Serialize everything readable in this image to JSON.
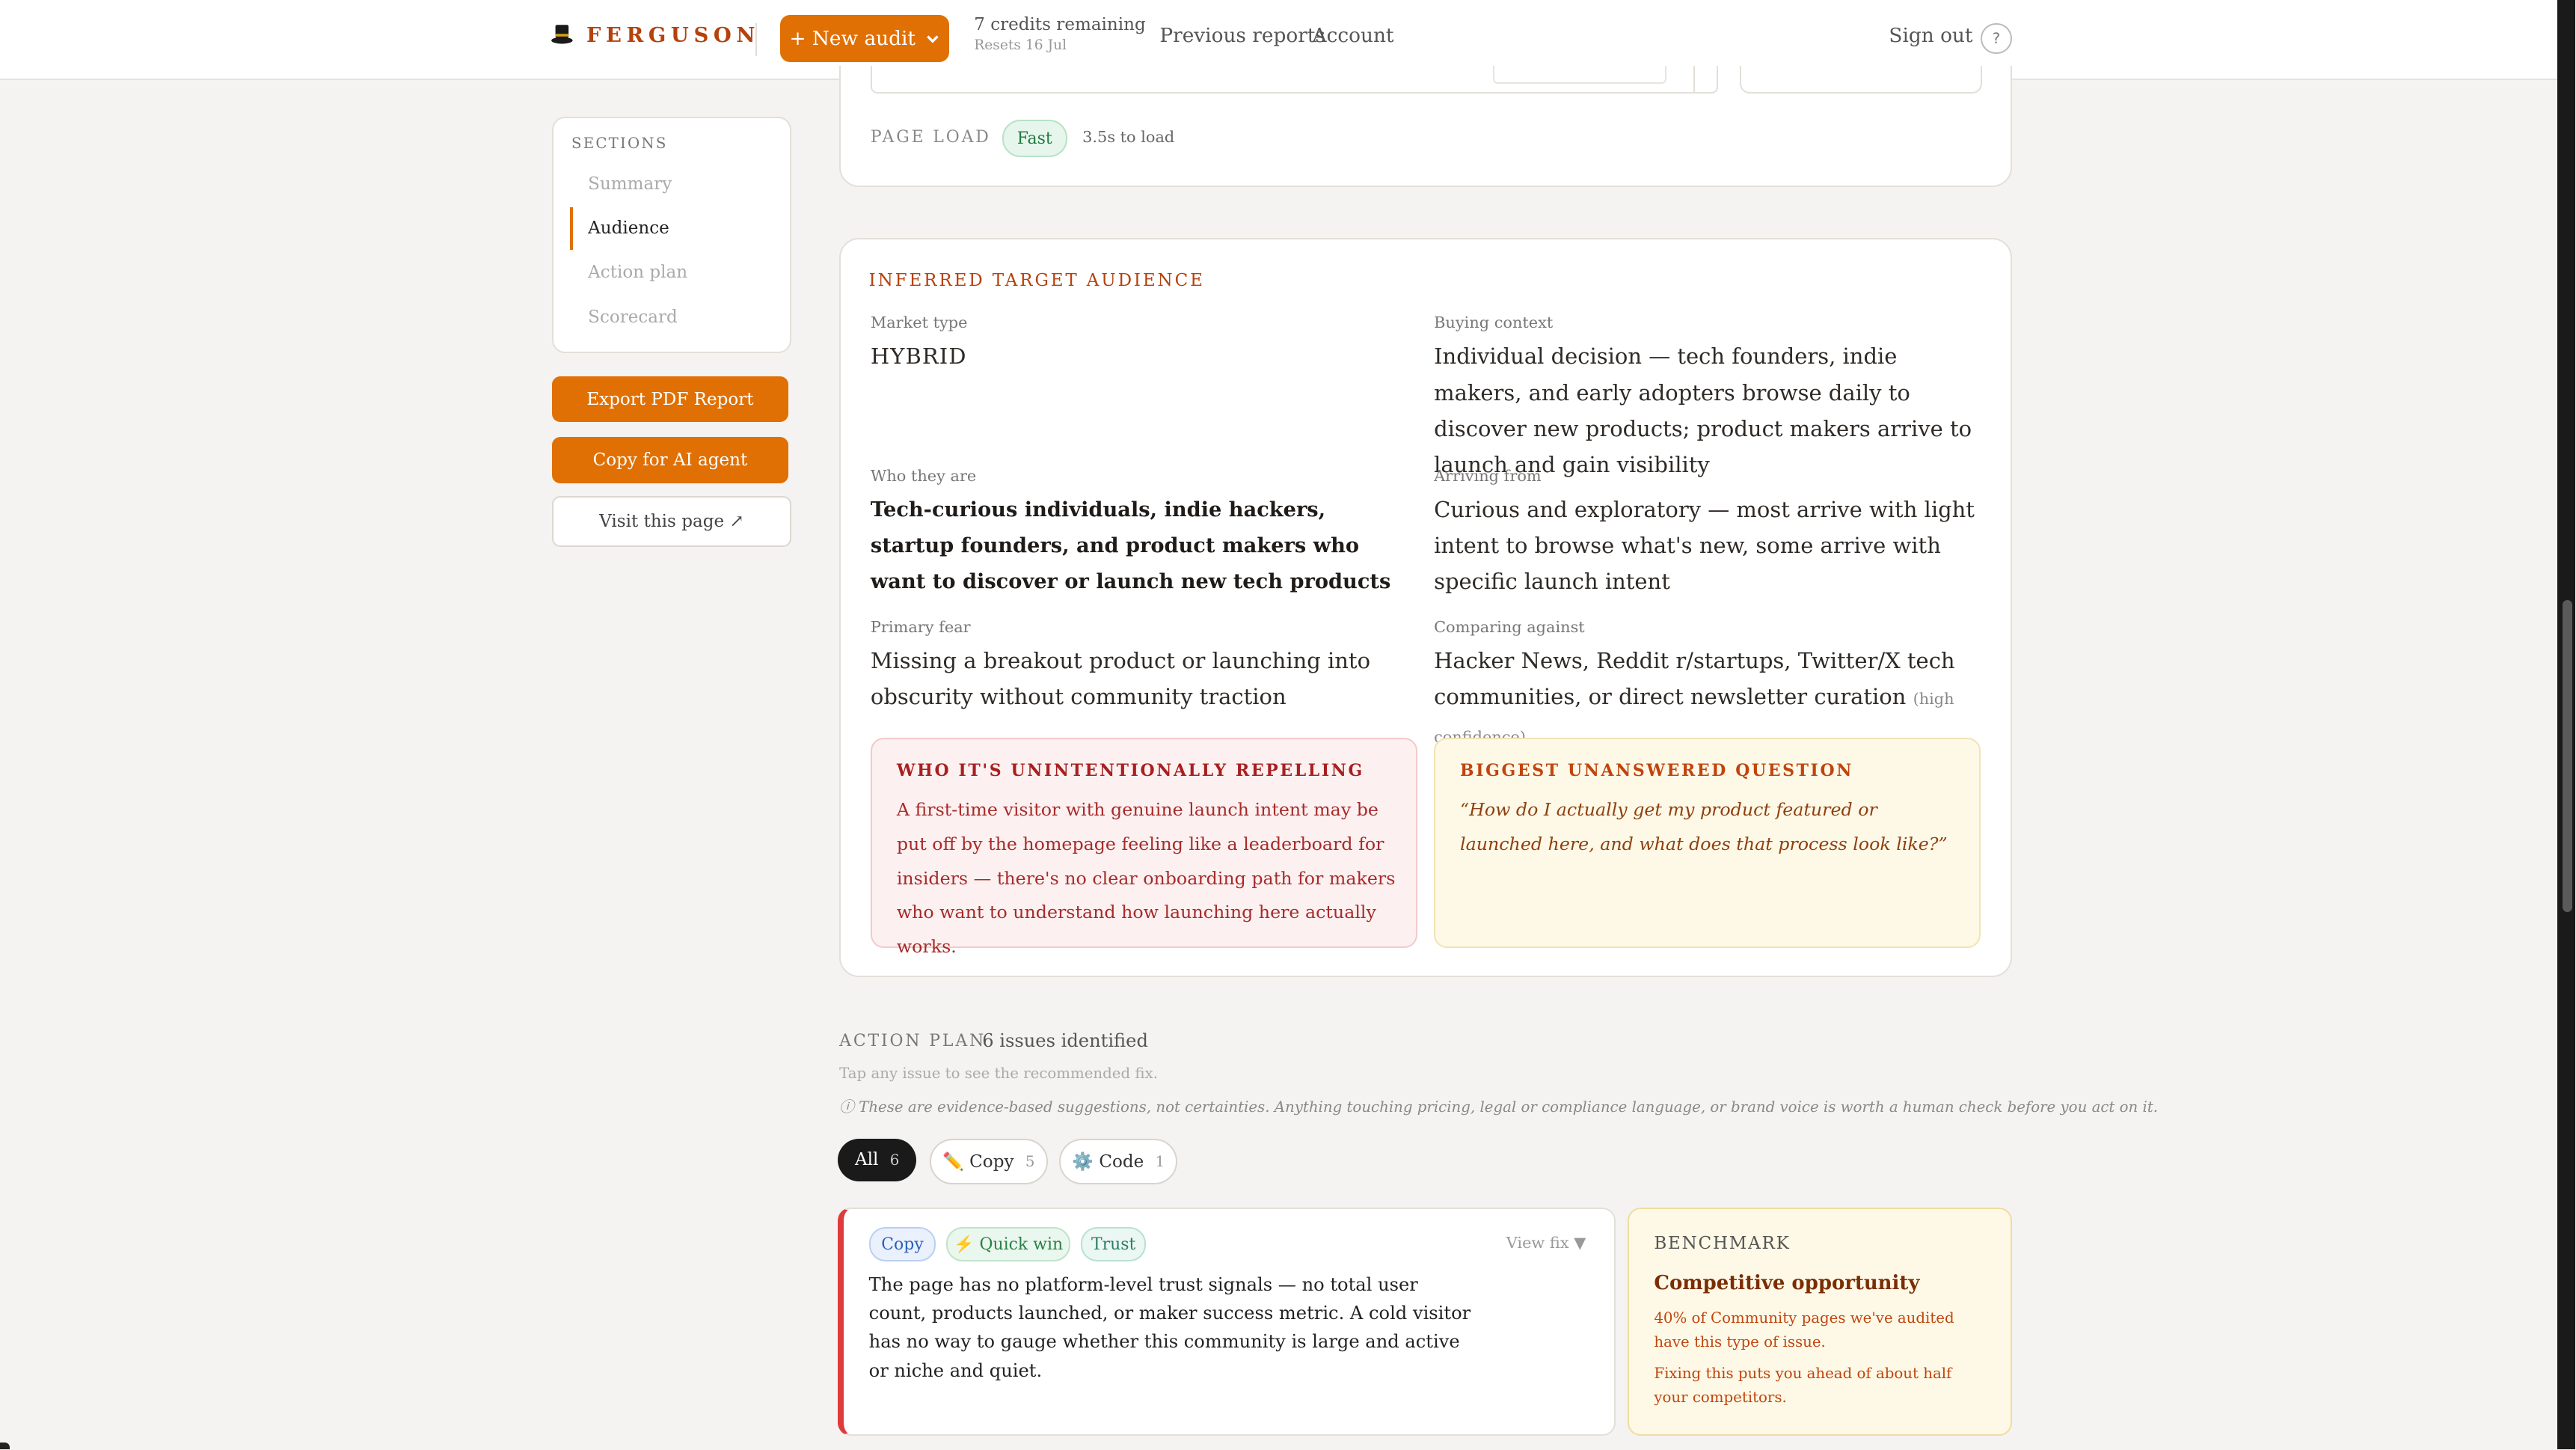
{
  "nav": {
    "brand": "FERGUSON",
    "new_audit": "+ New audit",
    "credits": "7 credits remaining",
    "resets": "Resets 16 Jul",
    "previous_reports": "Previous reports",
    "account": "Account",
    "sign_out": "Sign out",
    "help": "?"
  },
  "sidebar": {
    "title": "SECTIONS",
    "items": [
      "Summary",
      "Audience",
      "Action plan",
      "Scorecard"
    ],
    "active": "Audience",
    "export_pdf": "Export PDF Report",
    "copy_ai": "Copy for AI agent",
    "visit_page": "Visit this page ↗"
  },
  "page_load": {
    "label": "PAGE LOAD",
    "badge": "Fast",
    "time": "3.5s to load"
  },
  "audience": {
    "title": "INFERRED TARGET AUDIENCE",
    "market_type_label": "Market type",
    "market_type": "HYBRID",
    "buying_context_label": "Buying context",
    "buying_context": "Individual decision — tech founders, indie makers, and early adopters browse daily to discover new products; product makers arrive to launch and gain visibility",
    "who_label": "Who they are",
    "who": "Tech-curious individuals, indie hackers, startup founders, and product makers who want to discover or launch new tech products",
    "arriving_label": "Arriving from",
    "arriving": "Curious and exploratory — most arrive with light intent to browse what's new, some arrive with specific launch intent",
    "fear_label": "Primary fear",
    "fear": "Missing a breakout product or launching into obscurity without community traction",
    "comparing_label": "Comparing against",
    "comparing": "Hacker News, Reddit r/startups, Twitter/X tech communities, or direct newsletter curation",
    "confidence": "(high confidence)",
    "repelling_title": "WHO IT'S UNINTENTIONALLY REPELLING",
    "repelling_text": "A first-time visitor with genuine launch intent may be put off by the homepage feeling like a leaderboard for insiders — there's no clear onboarding path for makers who want to understand how launching here actually works.",
    "question_title": "BIGGEST UNANSWERED QUESTION",
    "question_text": "“How do I actually get my product featured or launched here, and what does that process look like?”"
  },
  "action_plan": {
    "label": "ACTION PLAN",
    "count": "6 issues identified",
    "tap_hint": "Tap any issue to see the recommended fix.",
    "note": "ⓘ These are evidence-based suggestions, not certainties. Anything touching pricing, legal or compliance language, or brand voice is worth a human check before you act on it.",
    "filters": [
      {
        "label": "All",
        "count": "6"
      },
      {
        "label": "✏️ Copy",
        "count": "5"
      },
      {
        "label": "⚙️ Code",
        "count": "1"
      }
    ],
    "issue": {
      "tags": [
        "Copy",
        "⚡ Quick win",
        "Trust"
      ],
      "view_fix": "View fix ▼",
      "text": "The page has no platform-level trust signals — no total user count, products launched, or maker success metric. A cold visitor has no way to gauge whether this community is large and active or niche and quiet."
    },
    "benchmark": {
      "title": "BENCHMARK",
      "heading": "Competitive opportunity",
      "p1": "40% of Community pages we've audited have this type of issue.",
      "p2": "Fixing this puts you ahead of about half your competitors."
    }
  },
  "colors": {
    "accent": "#e07004",
    "brand": "#b5420c",
    "danger": "#e03b3b",
    "success": "#1f7a3e"
  }
}
